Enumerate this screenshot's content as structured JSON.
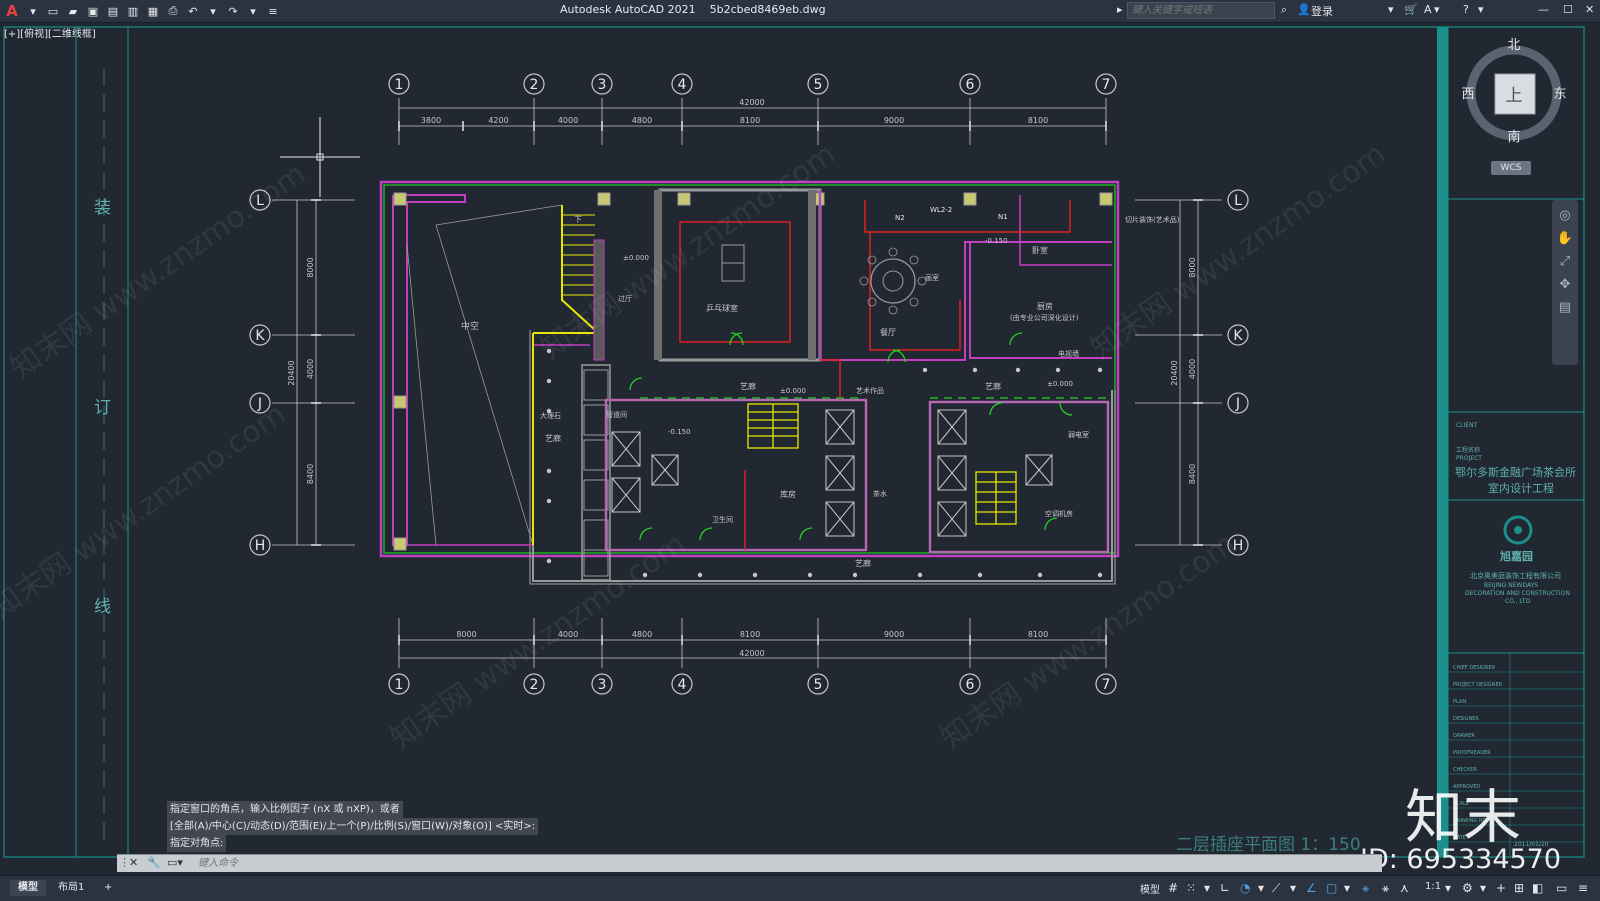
{
  "app": {
    "logo": "A",
    "title": "Autodesk AutoCAD 2021",
    "file": "5b2cbed8469eb.dwg",
    "search_placeholder": "键入关键字或短语",
    "login_label": "登录"
  },
  "viewport": {
    "label": "[+][俯视][二维线框]"
  },
  "drawing": {
    "grid_columns": [
      "1",
      "2",
      "3",
      "4",
      "5",
      "6",
      "7"
    ],
    "grid_rows": [
      "L",
      "K",
      "J",
      "H"
    ],
    "top_total": "42000",
    "top_dims": [
      "3800",
      "4200",
      "4000",
      "4800",
      "8100",
      "9000",
      "8100"
    ],
    "bottom_total": "42000",
    "bottom_dims": [
      "8000",
      "4000",
      "4800",
      "8100",
      "9000",
      "8100"
    ],
    "left_total": "20400",
    "left_dims": [
      "8000",
      "4000",
      "8400"
    ],
    "right_total": "20400",
    "right_dims": [
      "8000",
      "4000",
      "8400"
    ],
    "binding_chars": [
      "装",
      "订",
      "线"
    ],
    "rooms": {
      "atrium": "中空",
      "pingpong": "乒乓球室",
      "gallery1": "艺廊",
      "gallery2": "艺廊",
      "gallery3": "艺廊",
      "gallery4": "艺廊",
      "dining": "餐厅",
      "bedroom": "卧室",
      "kitchen": "厨房",
      "kitchen_note": "(由专业公司深化设计)",
      "storage": "库房",
      "restroom": "卫生间",
      "weak_room": "弱电室",
      "ac_room": "空调机房",
      "artwork": "艺术作品",
      "passage": "过厅",
      "elev_down": "下",
      "tea": "茶水",
      "warehouse": "管道间",
      "drawing_room": "画室",
      "cut": "切片装饰(艺术品)",
      "tv_room": "电视墙",
      "marble": "大理石",
      "level_a": "±0.000",
      "level_b": "-0.150",
      "level_c": "±0.000",
      "level_d": "-0.150",
      "level_e": "±0.000",
      "circuit_n1": "N1",
      "circuit_n2": "N2",
      "circuit_wl": "WL2-2"
    }
  },
  "title_block": {
    "client_label": "CLIENT",
    "project_label": "PROJECT",
    "project_cn": "工程名称",
    "project_name_1": "鄂尔多斯金融广场茶会所",
    "project_name_2": "室内设计工程",
    "company_cn": "北京奥美庭装饰工程有限公司",
    "company_en_1": "BEIJING NEWDAYS",
    "company_en_2": "DECORATION AND CONSTRUCTION",
    "company_en_3": "CO., LTD",
    "company_logo": "旭嘉园",
    "rows": [
      "CHIEF DESIGNER",
      "PROJECT DESIGNER",
      "PLAN",
      "DESIGNER",
      "DRAWER",
      "PROOFREADER",
      "CHECKER",
      "APPROVED",
      "SCALE",
      "DRAWING NO.",
      "DATE"
    ],
    "date": "2011/01/20"
  },
  "viewcube": {
    "north": "北",
    "south": "南",
    "west": "西",
    "east": "东",
    "top": "上",
    "wcs": "WCS"
  },
  "drawing_title": "二层插座平面图 1：150",
  "command": {
    "history": [
      "指定窗口的角点，输入比例因子 (nX 或 nXP)，或者",
      "[全部(A)/中心(C)/动态(D)/范围(E)/上一个(P)/比例(S)/窗口(W)/对象(O)] <实时>:",
      "指定对角点:"
    ],
    "input_placeholder": "键入命令"
  },
  "status": {
    "tab_model": "模型",
    "tab_layout": "布局1",
    "add": "+",
    "model_label": "模型",
    "scale": "1:1"
  },
  "watermark": {
    "logo": "知末",
    "id": "ID: 695334570",
    "site": "知末网 www.znzmo.com"
  },
  "colors": {
    "bg": "#212832",
    "wall": "#9a9a9a",
    "purple": "#c040c0",
    "red": "#e02020",
    "green": "#20d020",
    "yellow": "#e6e600",
    "teal": "#1b8f8a"
  }
}
